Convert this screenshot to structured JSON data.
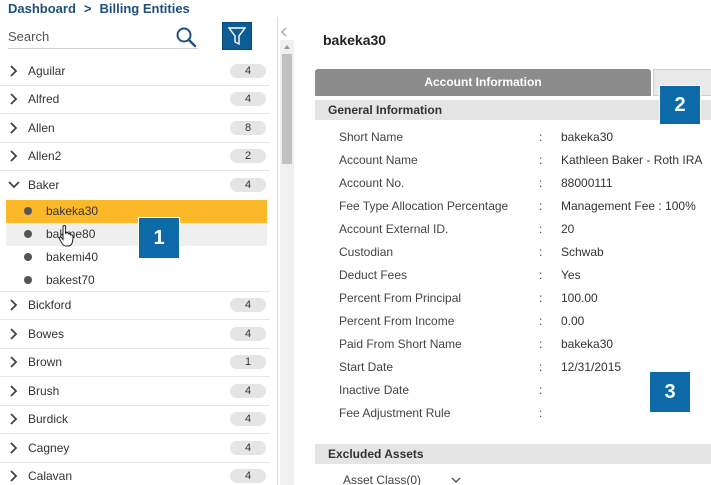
{
  "breadcrumb": {
    "root": "Dashboard",
    "separator": ">",
    "current": "Billing Entities"
  },
  "search": {
    "placeholder": "Search"
  },
  "list": {
    "groups_top": [
      {
        "name": "Aguilar",
        "count": "4"
      },
      {
        "name": "Alfred",
        "count": "4"
      },
      {
        "name": "Allen",
        "count": "8"
      },
      {
        "name": "Allen2",
        "count": "2"
      }
    ],
    "expanded": {
      "name": "Baker",
      "count": "4",
      "children": [
        "bakeka30",
        "bakme80",
        "bakemi40",
        "bakest70"
      ]
    },
    "groups_bottom": [
      {
        "name": "Bickford",
        "count": "4"
      },
      {
        "name": "Bowes",
        "count": "4"
      },
      {
        "name": "Brown",
        "count": "1"
      },
      {
        "name": "Brush",
        "count": "4"
      },
      {
        "name": "Burdick",
        "count": "4"
      },
      {
        "name": "Cagney",
        "count": "4"
      },
      {
        "name": "Calavan",
        "count": "4"
      }
    ]
  },
  "detail": {
    "title": "bakeka30",
    "tab_active": "Account Information",
    "general_header": "General Information",
    "fields": [
      {
        "label": "Short Name",
        "value": "bakeka30"
      },
      {
        "label": "Account Name",
        "value": "Kathleen Baker - Roth IRA"
      },
      {
        "label": "Account No.",
        "value": "88000111"
      },
      {
        "label": "Fee Type Allocation Percentage",
        "value": "Management Fee : 100%"
      },
      {
        "label": "Account External ID.",
        "value": "20"
      },
      {
        "label": "Custodian",
        "value": "Schwab"
      },
      {
        "label": "Deduct Fees",
        "value": "Yes"
      },
      {
        "label": "Percent From Principal",
        "value": "100.00"
      },
      {
        "label": "Percent From Income",
        "value": "0.00"
      },
      {
        "label": "Paid From Short Name",
        "value": "bakeka30"
      },
      {
        "label": "Start Date",
        "value": "12/31/2015"
      },
      {
        "label": "Inactive Date",
        "value": ""
      },
      {
        "label": "Fee Adjustment Rule",
        "value": ""
      }
    ],
    "colon": ":",
    "excluded_header": "Excluded Assets",
    "asset_class": "Asset Class(0)"
  },
  "callouts": [
    "1",
    "2",
    "3"
  ],
  "colors": {
    "accent": "#0d6aa8",
    "selected": "#fbb829",
    "brand": "#1f4f7f"
  }
}
